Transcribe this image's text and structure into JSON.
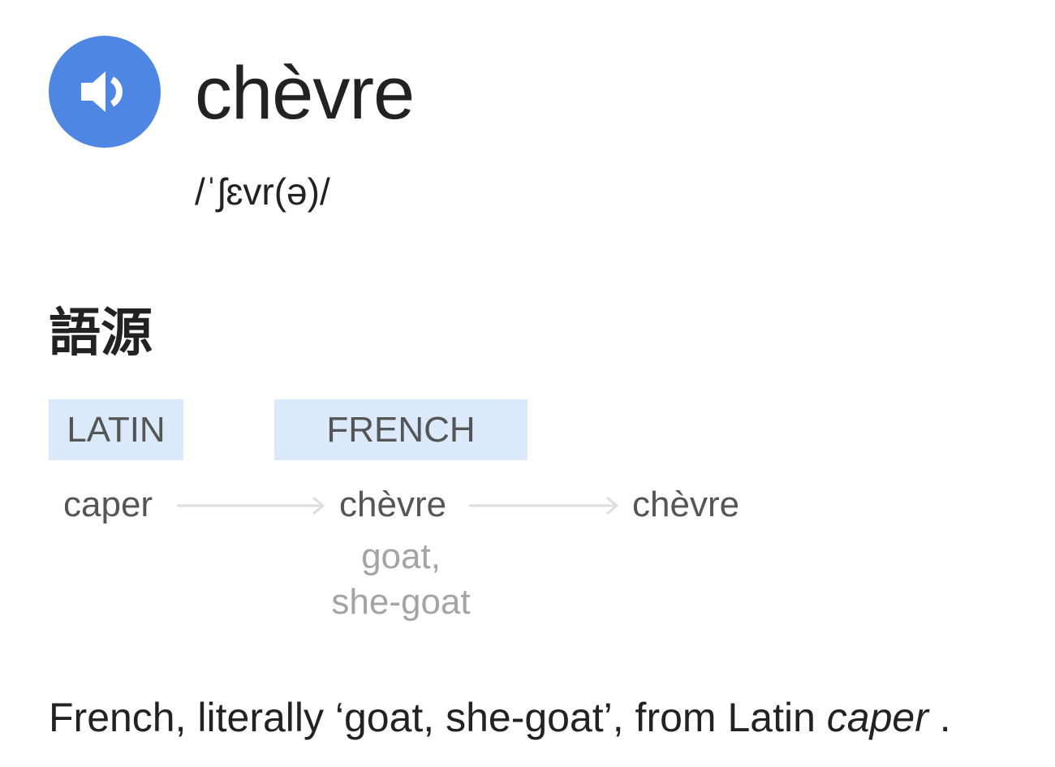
{
  "entry": {
    "headword": "chèvre",
    "pronunciation": "/ˈʃɛvr(ə)/",
    "audio_icon": "speaker-icon",
    "accent_color": "#4e86e4"
  },
  "origin": {
    "section_title": "語源",
    "languages": [
      {
        "label": "LATIN",
        "word": "caper"
      },
      {
        "label": "FRENCH",
        "word": "chèvre",
        "gloss": [
          "goat,",
          "she-goat"
        ]
      }
    ],
    "result_word": "chèvre",
    "box_color": "#dbeafb",
    "definition": {
      "prefix": "French, literally ‘goat, she-goat’, from Latin ",
      "italic": "caper",
      "suffix": " ."
    }
  }
}
